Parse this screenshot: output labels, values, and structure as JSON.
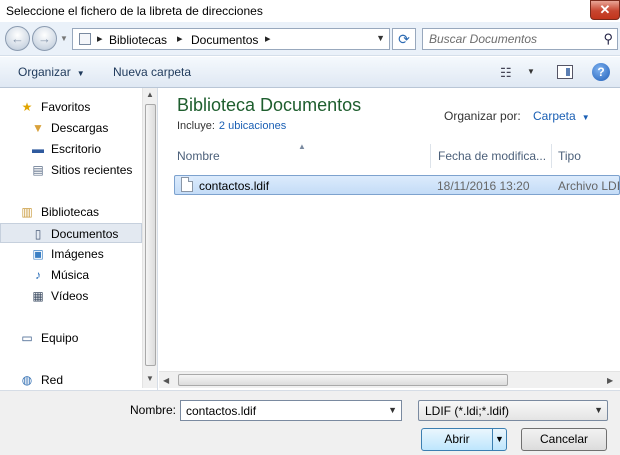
{
  "window": {
    "title": "Seleccione el fichero de la libreta de direcciones",
    "close_glyph": "✕"
  },
  "navbar": {
    "address_segments": [
      "Bibliotecas",
      "Documentos"
    ],
    "search_placeholder": "Buscar Documentos"
  },
  "toolbar": {
    "organize_label": "Organizar",
    "new_folder_label": "Nueva carpeta",
    "help_glyph": "?"
  },
  "sidebar": {
    "items": [
      {
        "label": "Favoritos",
        "icon": "star-icon"
      },
      {
        "label": "Descargas",
        "icon": "downloads-folder-icon"
      },
      {
        "label": "Escritorio",
        "icon": "desktop-icon"
      },
      {
        "label": "Sitios recientes",
        "icon": "recent-places-icon"
      },
      {
        "label": "Bibliotecas",
        "icon": "libraries-icon"
      },
      {
        "label": "Documentos",
        "icon": "documents-icon",
        "selected": true
      },
      {
        "label": "Imágenes",
        "icon": "pictures-icon"
      },
      {
        "label": "Música",
        "icon": "music-icon"
      },
      {
        "label": "Vídeos",
        "icon": "videos-icon"
      },
      {
        "label": "Equipo",
        "icon": "computer-icon"
      },
      {
        "label": "Red",
        "icon": "network-icon"
      }
    ]
  },
  "main": {
    "library_title": "Biblioteca Documentos",
    "includes_label": "Incluye:",
    "includes_link": "2 ubicaciones",
    "arrange_label": "Organizar por:",
    "arrange_value": "Carpeta",
    "columns": [
      "Nombre",
      "Fecha de modifica...",
      "Tipo"
    ],
    "files": [
      {
        "name": "contactos.ldif",
        "date": "18/11/2016 13:20",
        "type": "Archivo LDIF",
        "selected": true
      }
    ]
  },
  "footer": {
    "filename_label": "Nombre:",
    "filename_value": "contactos.ldif",
    "filter_value": "LDIF (*.ldi;*.ldif)",
    "open_label": "Abrir",
    "cancel_label": "Cancelar"
  },
  "colors": {
    "library_title": "#1e5e2e",
    "link": "#1a5fb4",
    "selection": "#c4dcf7"
  }
}
